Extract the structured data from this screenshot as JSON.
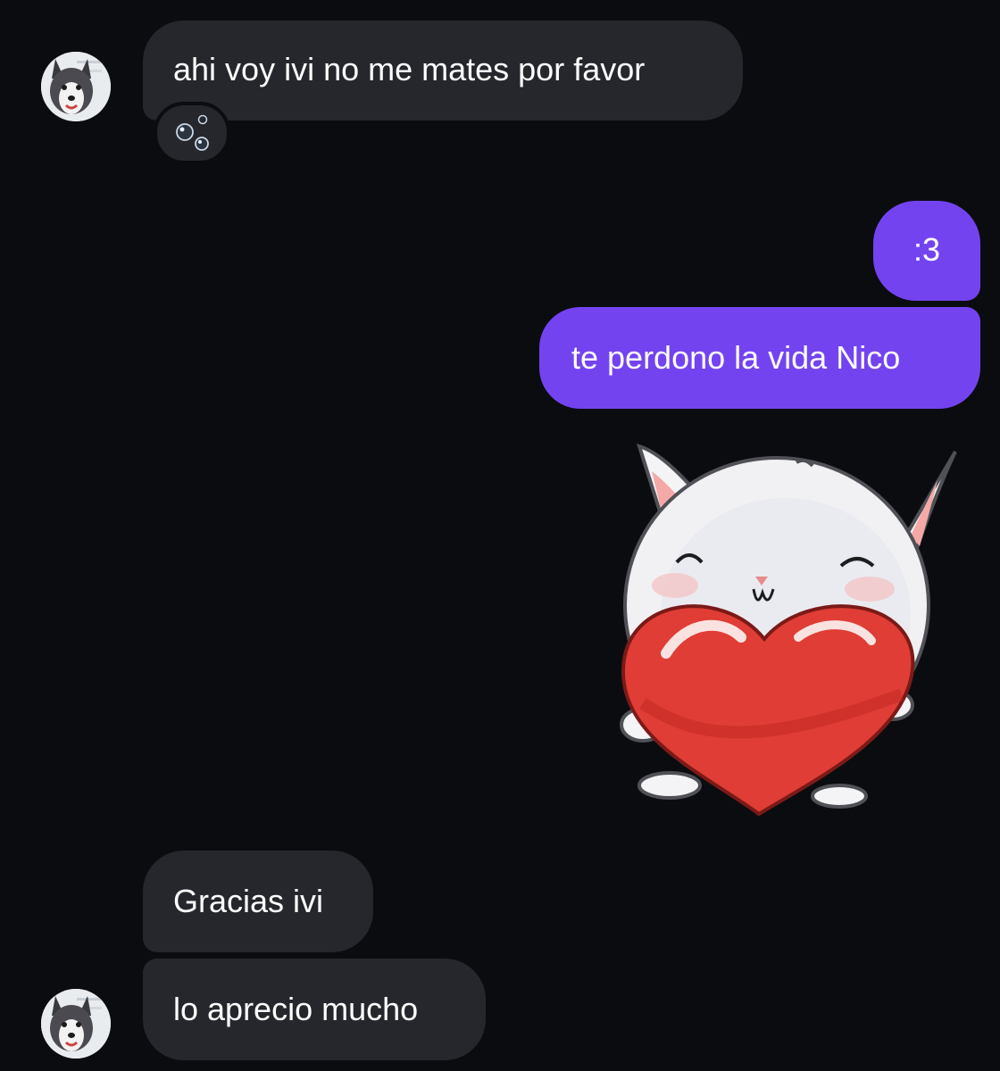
{
  "conversation": {
    "messages": [
      {
        "sender": "contact",
        "text": "ahi voy ivi no me mates por favor",
        "reaction": "bubbles-reaction"
      },
      {
        "sender": "me",
        "text": ":3"
      },
      {
        "sender": "me",
        "text": "te perdono la vida Nico"
      },
      {
        "sender": "me",
        "sticker": "bunny-holding-heart"
      },
      {
        "sender": "contact",
        "text": "Gracias ivi"
      },
      {
        "sender": "contact",
        "text": "lo aprecio mucho"
      }
    ]
  },
  "colors": {
    "background": "#0b0c10",
    "incoming_bubble": "#25272c",
    "outgoing_bubble": "#7443f0",
    "text": "#ffffff"
  },
  "icons": {
    "avatar": "husky-dog-avatar",
    "reaction": "bubbles-icon",
    "sticker": "bunny-heart-sticker"
  }
}
